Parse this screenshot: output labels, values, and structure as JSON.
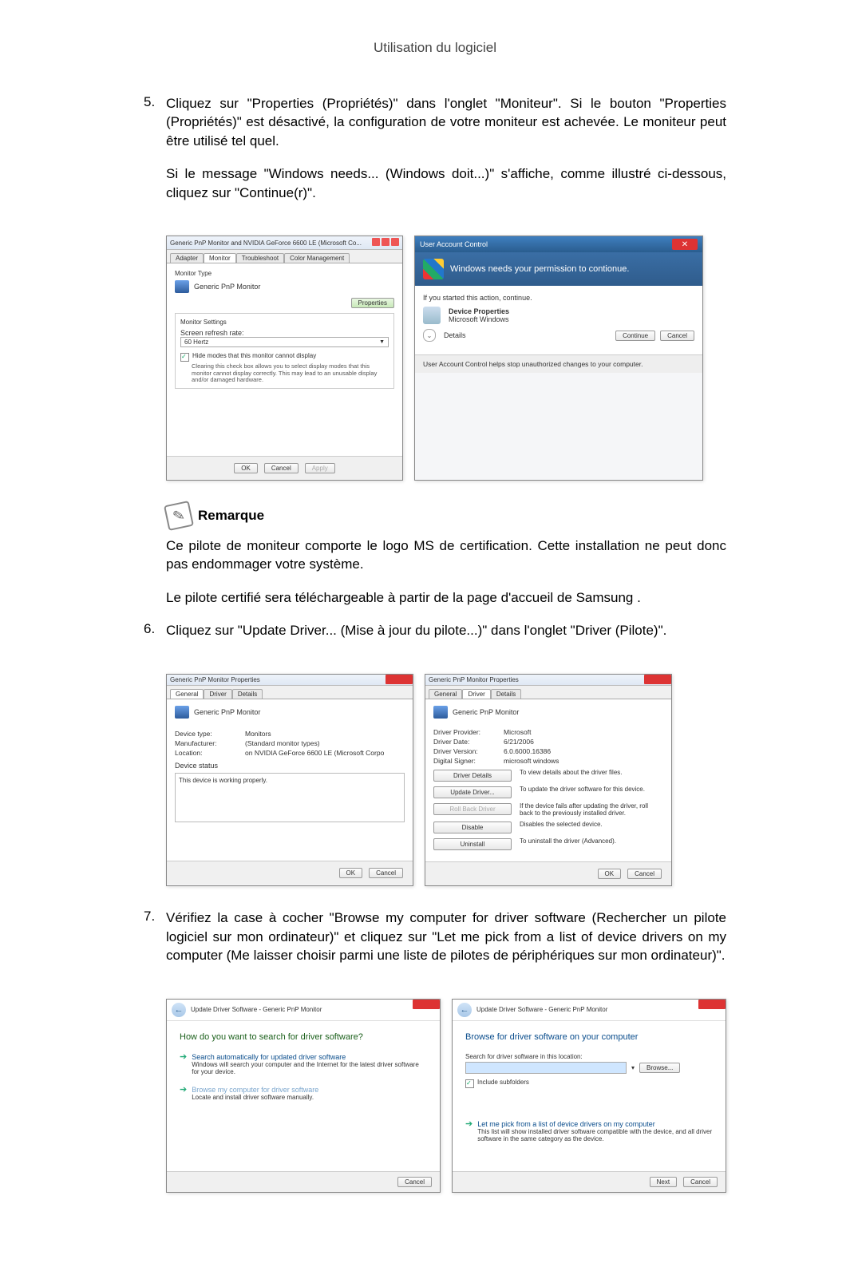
{
  "header": {
    "title": "Utilisation du logiciel"
  },
  "step5": {
    "number": "5.",
    "p1": "Cliquez sur \"Properties (Propriétés)\" dans l'onglet \"Moniteur\". Si le bouton \"Properties (Propriétés)\" est désactivé, la configuration de votre moniteur est achevée. Le moniteur peut être utilisé tel quel.",
    "p2": "Si le message \"Windows needs... (Windows doit...)\" s'affiche, comme illustré ci-dessous, cliquez sur \"Continue(r)\"."
  },
  "fig_monitor": {
    "title": "Generic PnP Monitor and NVIDIA GeForce 6600 LE (Microsoft Co...",
    "tabs": {
      "adapter": "Adapter",
      "monitor": "Monitor",
      "troubleshoot": "Troubleshoot",
      "color": "Color Management"
    },
    "monitor_type_label": "Monitor Type",
    "monitor_name": "Generic PnP Monitor",
    "properties_btn": "Properties",
    "settings_label": "Monitor Settings",
    "refresh_label": "Screen refresh rate:",
    "refresh_value": "60 Hertz",
    "hide_modes": "Hide modes that this monitor cannot display",
    "hide_help": "Clearing this check box allows you to select display modes that this monitor cannot display correctly. This may lead to an unusable display and/or damaged hardware.",
    "ok": "OK",
    "cancel": "Cancel",
    "apply": "Apply"
  },
  "fig_uac": {
    "title": "User Account Control",
    "banner": "Windows needs your permission to contionue.",
    "started": "If you started this action, continue.",
    "prog_name": "Device Properties",
    "publisher": "Microsoft Windows",
    "details": "Details",
    "continue": "Continue",
    "cancel": "Cancel",
    "footer": "User Account Control helps stop unauthorized changes to your computer."
  },
  "remark": {
    "title": "Remarque",
    "p1": "Ce pilote de moniteur comporte le logo MS de certification. Cette installation ne peut donc pas endommager votre système.",
    "p2": "Le pilote certifié sera téléchargeable à partir de la page d'accueil de Samsung ."
  },
  "step6": {
    "number": "6.",
    "p1": "Cliquez sur \"Update Driver... (Mise à jour du pilote...)\" dans l'onglet \"Driver (Pilote)\"."
  },
  "fig_prop_general": {
    "title": "Generic PnP Monitor Properties",
    "tabs": {
      "general": "General",
      "driver": "Driver",
      "details": "Details"
    },
    "name": "Generic PnP Monitor",
    "rows": {
      "device_type_k": "Device type:",
      "device_type_v": "Monitors",
      "manufacturer_k": "Manufacturer:",
      "manufacturer_v": "(Standard monitor types)",
      "location_k": "Location:",
      "location_v": "on NVIDIA GeForce 6600 LE (Microsoft Corpo"
    },
    "status_label": "Device status",
    "status_text": "This device is working properly.",
    "ok": "OK",
    "cancel": "Cancel"
  },
  "fig_prop_driver": {
    "title": "Generic PnP Monitor Properties",
    "tabs": {
      "general": "General",
      "driver": "Driver",
      "details": "Details"
    },
    "name": "Generic PnP Monitor",
    "rows": {
      "provider_k": "Driver Provider:",
      "provider_v": "Microsoft",
      "date_k": "Driver Date:",
      "date_v": "6/21/2006",
      "version_k": "Driver Version:",
      "version_v": "6.0.6000.16386",
      "signer_k": "Digital Signer:",
      "signer_v": "microsoft windows"
    },
    "btn_details": "Driver Details",
    "desc_details": "To view details about the driver files.",
    "btn_update": "Update Driver...",
    "desc_update": "To update the driver software for this device.",
    "btn_rollback": "Roll Back Driver",
    "desc_rollback": "If the device fails after updating the driver, roll back to the previously installed driver.",
    "btn_disable": "Disable",
    "desc_disable": "Disables the selected device.",
    "btn_uninstall": "Uninstall",
    "desc_uninstall": "To uninstall the driver (Advanced).",
    "ok": "OK",
    "cancel": "Cancel"
  },
  "step7": {
    "number": "7.",
    "p1": "Vérifiez la case à cocher \"Browse my computer for driver software (Rechercher un pilote logiciel sur mon ordinateur)\" et cliquez sur \"Let me pick from a list of device drivers on my computer (Me laisser choisir parmi une liste de pilotes de périphériques sur mon ordinateur)\"."
  },
  "fig_wiz1": {
    "breadcrumb": "Update Driver Software - Generic PnP Monitor",
    "heading": "How do you want to search for driver software?",
    "opt1_t": "Search automatically for updated driver software",
    "opt1_d": "Windows will search your computer and the Internet for the latest driver software for your device.",
    "opt2_t": "Browse my computer for driver software",
    "opt2_d": "Locate and install driver software manually.",
    "cancel": "Cancel"
  },
  "fig_wiz2": {
    "breadcrumb": "Update Driver Software - Generic PnP Monitor",
    "heading": "Browse for driver software on your computer",
    "search_label": "Search for driver software in this location:",
    "browse": "Browse...",
    "include": "Include subfolders",
    "opt_t": "Let me pick from a list of device drivers on my computer",
    "opt_d": "This list will show installed driver software compatible with the device, and all driver software in the same category as the device.",
    "next": "Next",
    "cancel": "Cancel"
  }
}
